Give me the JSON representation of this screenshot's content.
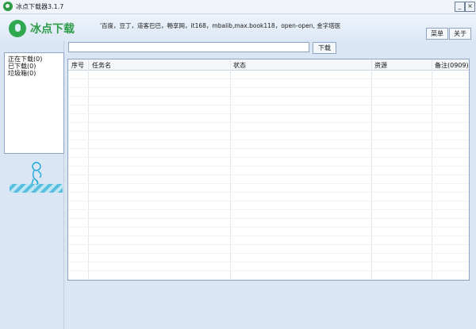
{
  "window": {
    "title": "冰点下载器3.1.7",
    "min_symbol": "_",
    "close_symbol": "×"
  },
  "brand": {
    "name": "冰点下载",
    "icon": "bingdian-logo-icon",
    "color": "#2c9c4a"
  },
  "header": {
    "sites_text": "'百度，豆丁，道客巴巴，畅享网，it168，mbalib,max.book118，open-open, 金字塔医",
    "menu_label": "菜单",
    "about_label": "关于"
  },
  "url_bar": {
    "value": "",
    "download_label": "下载"
  },
  "sidebar": {
    "items": [
      {
        "label": "正在下载(0)"
      },
      {
        "label": "已下载(0)"
      },
      {
        "label": "垃圾箱(0)"
      }
    ]
  },
  "table": {
    "columns": [
      {
        "label": "序号"
      },
      {
        "label": "任务名"
      },
      {
        "label": "状态"
      },
      {
        "label": "资源"
      },
      {
        "label": "备注(0909)"
      }
    ],
    "rows": []
  }
}
